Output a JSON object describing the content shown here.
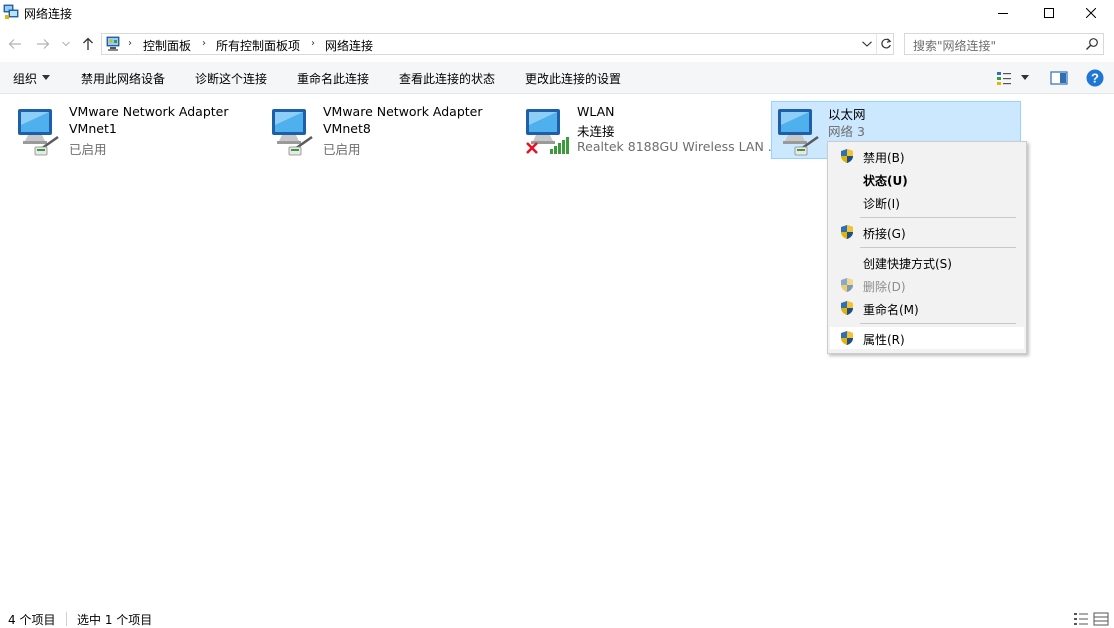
{
  "window": {
    "title": "网络连接",
    "icon": "network-connections-icon"
  },
  "address": {
    "crumbs": [
      "控制面板",
      "所有控制面板项",
      "网络连接"
    ],
    "search_placeholder": "搜索\"网络连接\""
  },
  "toolbar": {
    "organize": "组织",
    "disable": "禁用此网络设备",
    "diagnose": "诊断这个连接",
    "rename": "重命名此连接",
    "status": "查看此连接的状态",
    "settings": "更改此连接的设置"
  },
  "connections": [
    {
      "name": "VMware Network Adapter",
      "line2": "VMnet1",
      "line3": "已启用",
      "selected": false
    },
    {
      "name": "VMware Network Adapter",
      "line2": "VMnet8",
      "line3": "已启用",
      "selected": false
    },
    {
      "name": "WLAN",
      "line2": "未连接",
      "line3": "Realtek 8188GU Wireless LAN ...",
      "selected": false
    },
    {
      "name": "以太网",
      "line2": "网络 3",
      "line3": "",
      "selected": true
    }
  ],
  "context_menu": {
    "items": [
      {
        "label": "禁用(B)",
        "shield": true,
        "style": "normal"
      },
      {
        "label": "状态(U)",
        "shield": false,
        "style": "bold"
      },
      {
        "label": "诊断(I)",
        "shield": false,
        "style": "normal"
      },
      {
        "label": "桥接(G)",
        "shield": true,
        "style": "normal"
      },
      {
        "label": "创建快捷方式(S)",
        "shield": false,
        "style": "normal"
      },
      {
        "label": "删除(D)",
        "shield": true,
        "style": "disabled"
      },
      {
        "label": "重命名(M)",
        "shield": true,
        "style": "normal"
      },
      {
        "label": "属性(R)",
        "shield": true,
        "style": "hover"
      }
    ]
  },
  "statusbar": {
    "count": "4 个项目",
    "selected": "选中 1 个项目"
  },
  "colors": {
    "selection_bg": "#cce8ff",
    "selection_border": "#99d1ff",
    "menu_bg": "#f2f2f2",
    "help_blue": "#1e77d3",
    "error_red": "#e81123",
    "signal_green": "#3c9a3c"
  }
}
